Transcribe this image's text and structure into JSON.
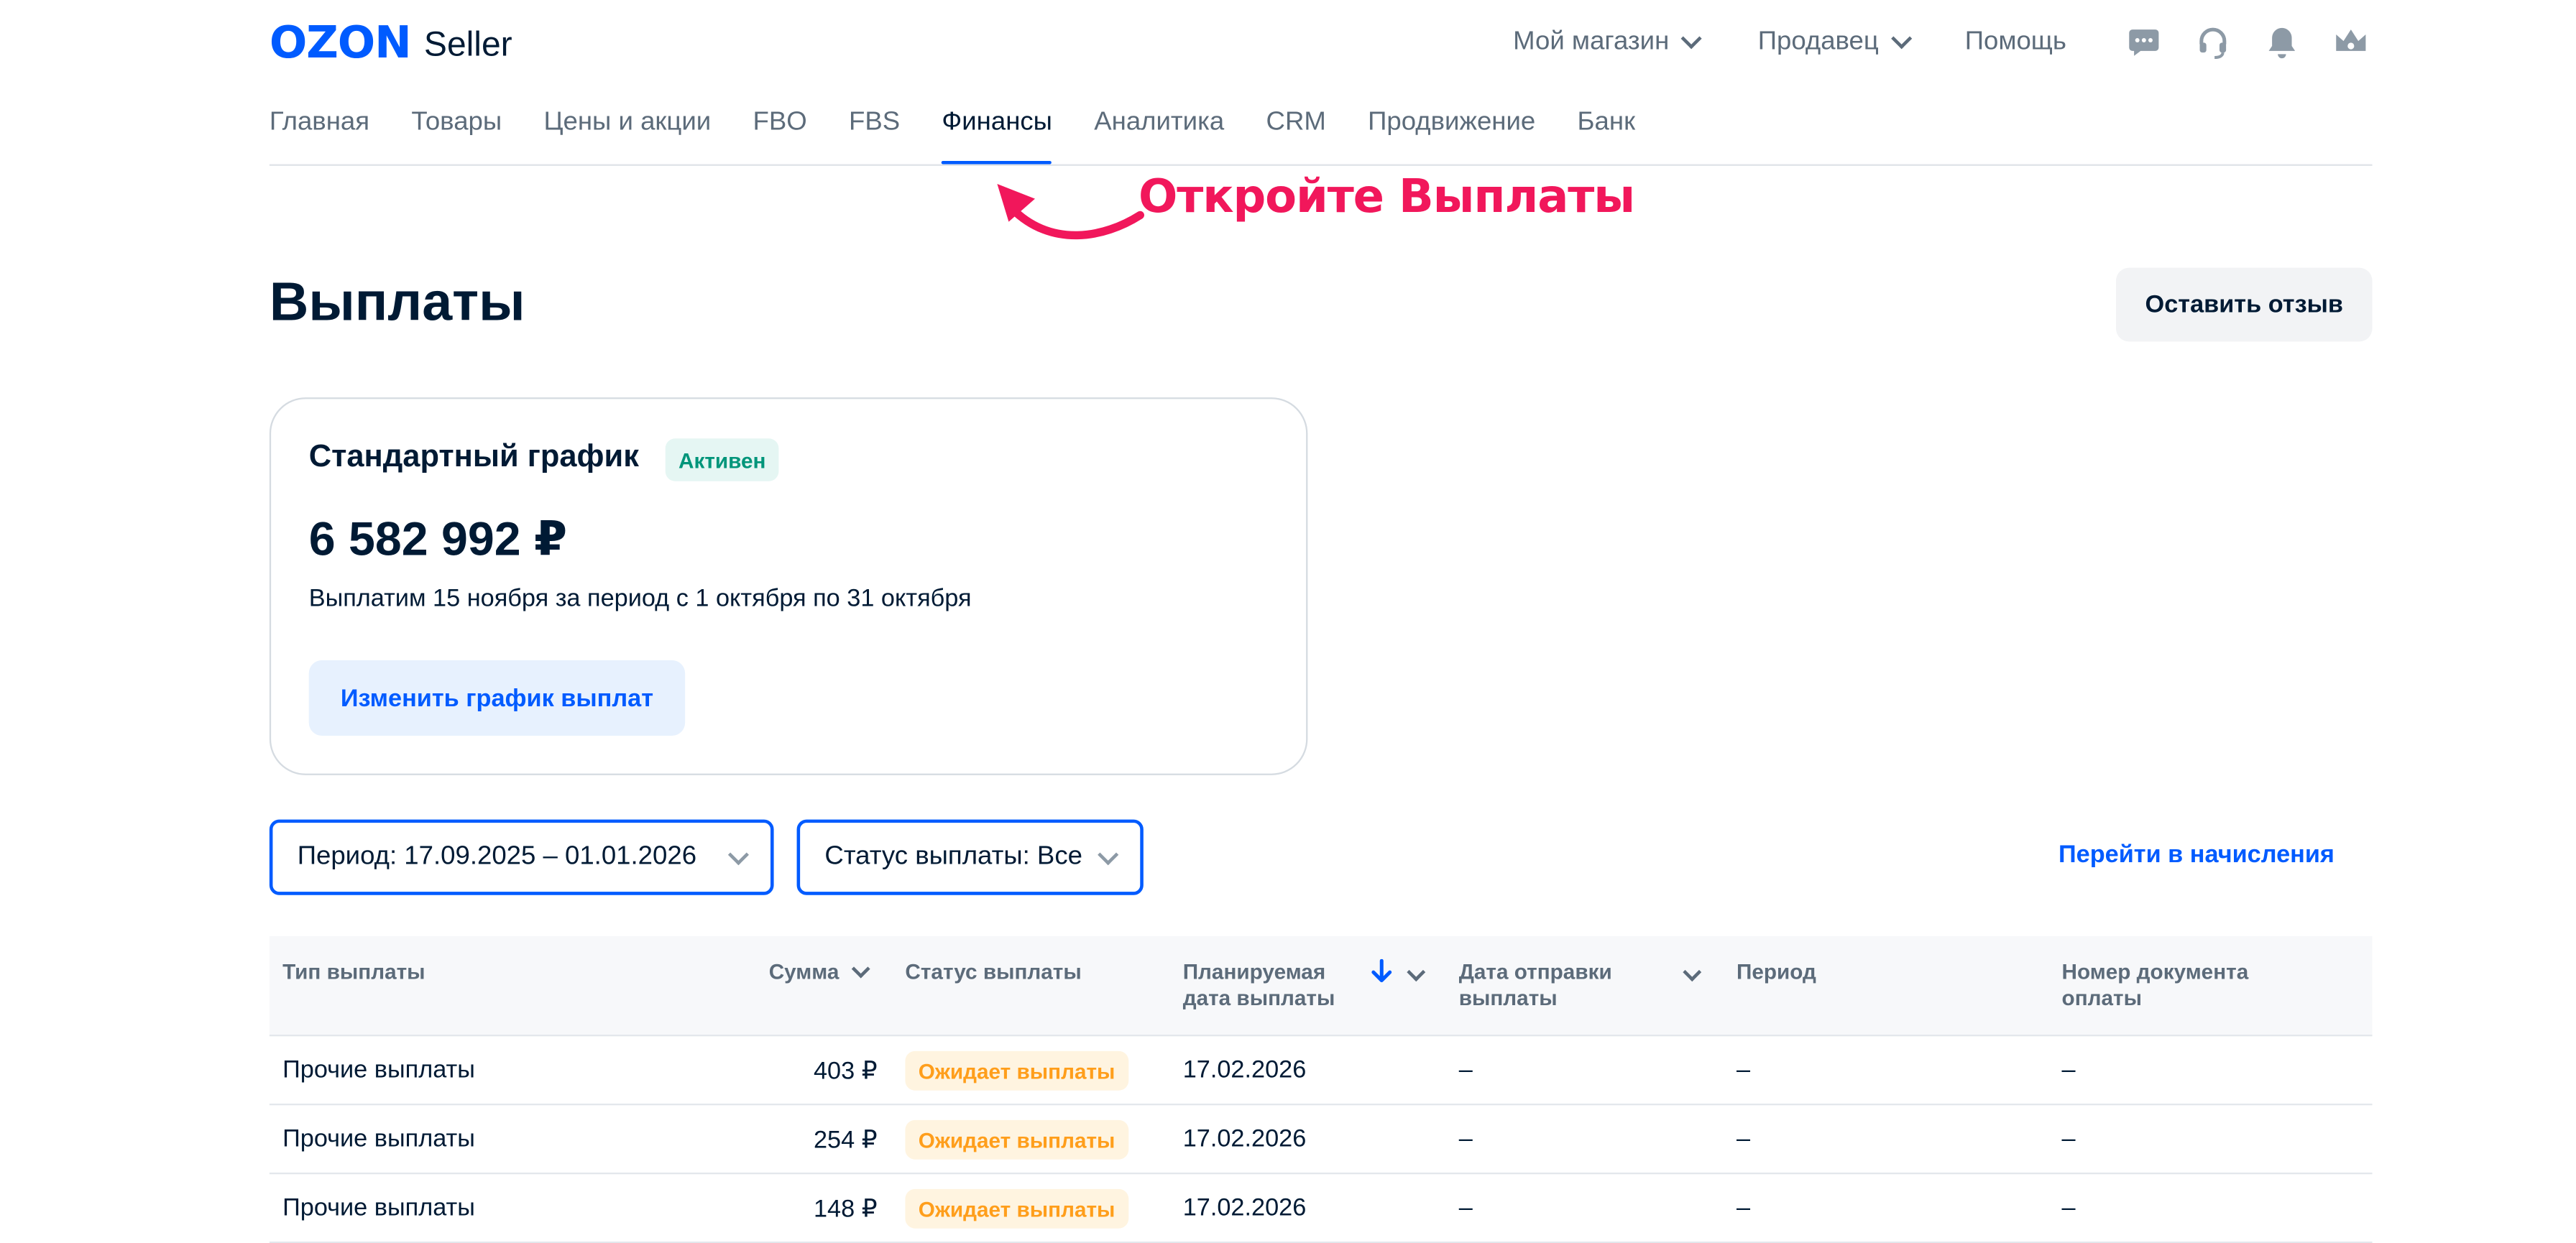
{
  "header": {
    "logo_brand": "OZON",
    "logo_product": "Seller",
    "menu_store": "Мой магазин",
    "menu_seller": "Продавец",
    "menu_help": "Помощь",
    "icons": [
      "chat-icon",
      "headset-icon",
      "bell-icon",
      "crown-icon"
    ]
  },
  "nav": {
    "tabs": [
      {
        "label": "Главная"
      },
      {
        "label": "Товары"
      },
      {
        "label": "Цены и акции"
      },
      {
        "label": "FBO"
      },
      {
        "label": "FBS"
      },
      {
        "label": "Финансы",
        "active": true
      },
      {
        "label": "Аналитика"
      },
      {
        "label": "CRM"
      },
      {
        "label": "Продвижение"
      },
      {
        "label": "Банк"
      }
    ]
  },
  "annotation": {
    "text": "Откройте Выплаты",
    "color": "#f1175b"
  },
  "page": {
    "title": "Выплаты",
    "feedback_button": "Оставить отзыв"
  },
  "schedule_card": {
    "title": "Стандартный график",
    "status_badge": "Активен",
    "amount": "6 582 992 ₽",
    "description": "Выплатим 15 ноября за период с 1 октября по 31 октября",
    "change_button": "Изменить график выплат"
  },
  "filters": {
    "period": "Период: 17.09.2025 – 01.01.2026",
    "status": "Статус выплаты: Все",
    "goto_link": "Перейти в начисления"
  },
  "table": {
    "columns": {
      "type": "Тип выплаты",
      "sum": "Сумма",
      "status": "Статус выплаты",
      "planned_date_line1": "Планируемая",
      "planned_date_line2": "дата выплаты",
      "sent_date_line1": "Дата отправки",
      "sent_date_line2": "выплаты",
      "period": "Период",
      "doc_number_line1": "Номер документа",
      "doc_number_line2": "оплаты"
    },
    "rows": [
      {
        "type": "Прочие выплаты",
        "sum": "403 ₽",
        "status": "Ожидает выплаты",
        "planned_date": "17.02.2026",
        "sent_date": "–",
        "period": "–",
        "doc_number": "–"
      },
      {
        "type": "Прочие выплаты",
        "sum": "254 ₽",
        "status": "Ожидает выплаты",
        "planned_date": "17.02.2026",
        "sent_date": "–",
        "period": "–",
        "doc_number": "–"
      },
      {
        "type": "Прочие выплаты",
        "sum": "148 ₽",
        "status": "Ожидает выплаты",
        "planned_date": "17.02.2026",
        "sent_date": "–",
        "period": "–",
        "doc_number": "–"
      }
    ]
  },
  "colors": {
    "accent": "#005bff",
    "active_badge_bg": "#e5f6f3",
    "active_badge_text": "#00957a",
    "pending_badge_bg": "#fff4e0",
    "pending_badge_text": "#ff9e1b"
  }
}
